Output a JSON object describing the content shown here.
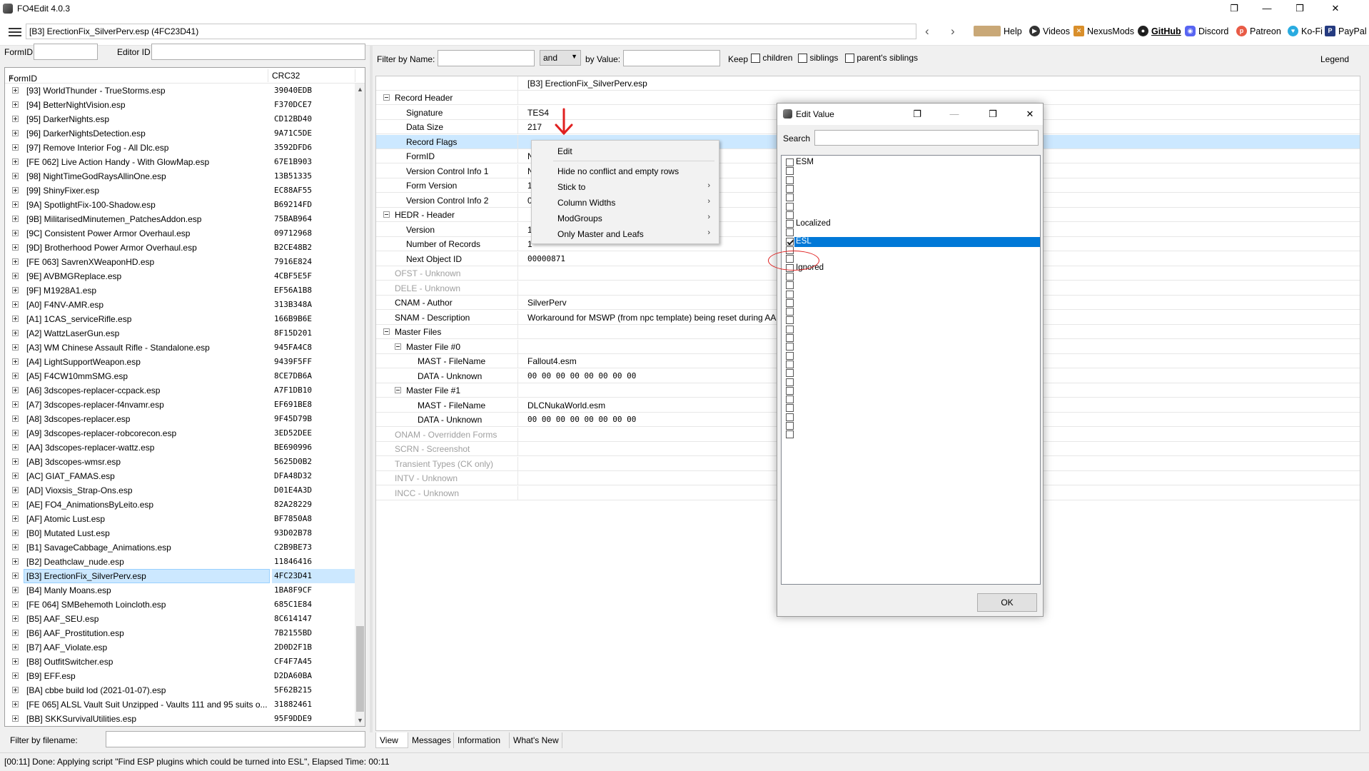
{
  "window": {
    "title": "FO4Edit 4.0.3",
    "controls": [
      "❐",
      "—",
      "❒",
      "✕"
    ]
  },
  "toolbar": {
    "path": "[B3] ErectionFix_SilverPerv.esp (4FC23D41)",
    "back": "‹",
    "forward": "›",
    "links": [
      {
        "label": "Help",
        "icon": "book-icon",
        "color": "#8a6a3a"
      },
      {
        "label": "Videos",
        "icon": "film-icon",
        "color": "#333333"
      },
      {
        "label": "NexusMods",
        "icon": "nexus-icon",
        "color": "#d98f2b"
      },
      {
        "label": "GitHub",
        "icon": "github-icon",
        "color": "#222222"
      },
      {
        "label": "Discord",
        "icon": "discord-icon",
        "color": "#5865f2"
      },
      {
        "label": "Patreon",
        "icon": "patreon-icon",
        "color": "#e85b46"
      },
      {
        "label": "Ko-Fi",
        "icon": "kofi-icon",
        "color": "#29abe0"
      },
      {
        "label": "PayPal",
        "icon": "paypal-icon",
        "color": "#253b80"
      }
    ]
  },
  "left": {
    "formid_label": "FormID",
    "formid_value": "",
    "editorid_label": "Editor ID",
    "editorid_value": "",
    "col_formid": "FormID",
    "col_crc": "CRC32",
    "filter_label": "Filter by filename:",
    "filter_value": "",
    "rows": [
      {
        "name": "[93] WorldThunder - TrueStorms.esp",
        "crc": "39040EDB"
      },
      {
        "name": "[94] BetterNightVision.esp",
        "crc": "F370DCE7"
      },
      {
        "name": "[95] DarkerNights.esp",
        "crc": "CD12BD40"
      },
      {
        "name": "[96] DarkerNightsDetection.esp",
        "crc": "9A71C5DE"
      },
      {
        "name": "[97] Remove Interior Fog - All Dlc.esp",
        "crc": "3592DFD6"
      },
      {
        "name": "[FE 062] Live Action Handy - With GlowMap.esp",
        "crc": "67E1B903"
      },
      {
        "name": "[98] NightTimeGodRaysAllinOne.esp",
        "crc": "13B51335"
      },
      {
        "name": "[99] ShinyFixer.esp",
        "crc": "EC88AF55"
      },
      {
        "name": "[9A] SpotlightFix-100-Shadow.esp",
        "crc": "B69214FD"
      },
      {
        "name": "[9B] MilitarisedMinutemen_PatchesAddon.esp",
        "crc": "75BAB964"
      },
      {
        "name": "[9C] Consistent Power Armor Overhaul.esp",
        "crc": "09712968"
      },
      {
        "name": "[9D] Brotherhood Power Armor Overhaul.esp",
        "crc": "B2CE48B2"
      },
      {
        "name": "[FE 063] SavrenXWeaponHD.esp",
        "crc": "7916E824"
      },
      {
        "name": "[9E] AVBMGReplace.esp",
        "crc": "4CBF5E5F"
      },
      {
        "name": "[9F] M1928A1.esp",
        "crc": "EF56A1B8"
      },
      {
        "name": "[A0] F4NV-AMR.esp",
        "crc": "313B348A"
      },
      {
        "name": "[A1] 1CAS_serviceRifle.esp",
        "crc": "166B9B6E"
      },
      {
        "name": "[A2] WattzLaserGun.esp",
        "crc": "8F15D201"
      },
      {
        "name": "[A3] WM Chinese Assault Rifle - Standalone.esp",
        "crc": "945FA4C8"
      },
      {
        "name": "[A4] LightSupportWeapon.esp",
        "crc": "9439F5FF"
      },
      {
        "name": "[A5] F4CW10mmSMG.esp",
        "crc": "8CE7DB6A"
      },
      {
        "name": "[A6] 3dscopes-replacer-ccpack.esp",
        "crc": "A7F1DB10"
      },
      {
        "name": "[A7] 3dscopes-replacer-f4nvamr.esp",
        "crc": "EF691BE8"
      },
      {
        "name": "[A8] 3dscopes-replacer.esp",
        "crc": "9F45D79B"
      },
      {
        "name": "[A9] 3dscopes-replacer-robcorecon.esp",
        "crc": "3ED52DEE"
      },
      {
        "name": "[AA] 3dscopes-replacer-wattz.esp",
        "crc": "BE690996"
      },
      {
        "name": "[AB] 3dscopes-wmsr.esp",
        "crc": "5625D0B2"
      },
      {
        "name": "[AC] GIAT_FAMAS.esp",
        "crc": "DFA48D32"
      },
      {
        "name": "[AD] Vioxsis_Strap-Ons.esp",
        "crc": "D01E4A3D"
      },
      {
        "name": "[AE] FO4_AnimationsByLeito.esp",
        "crc": "82A28229"
      },
      {
        "name": "[AF] Atomic Lust.esp",
        "crc": "BF7850A8"
      },
      {
        "name": "[B0] Mutated Lust.esp",
        "crc": "93D02B78"
      },
      {
        "name": "[B1] SavageCabbage_Animations.esp",
        "crc": "C2B9BE73"
      },
      {
        "name": "[B2] Deathclaw_nude.esp",
        "crc": "11846416"
      },
      {
        "name": "[B3] ErectionFix_SilverPerv.esp",
        "crc": "4FC23D41"
      },
      {
        "name": "[B4] Manly Moans.esp",
        "crc": "1BA8F9CF"
      },
      {
        "name": "[FE 064] SMBehemoth Loincloth.esp",
        "crc": "685C1E84"
      },
      {
        "name": "[B5] AAF_SEU.esp",
        "crc": "8C614147"
      },
      {
        "name": "[B6] AAF_Prostitution.esp",
        "crc": "7B2155BD"
      },
      {
        "name": "[B7] AAF_Violate.esp",
        "crc": "2D0D2F1B"
      },
      {
        "name": "[B8] OutfitSwitcher.esp",
        "crc": "CF4F7A45"
      },
      {
        "name": "[B9] EFF.esp",
        "crc": "D2DA60BA"
      },
      {
        "name": "[BA] cbbe build lod (2021-01-07).esp",
        "crc": "5F62B215"
      },
      {
        "name": "[FE 065] ALSL Vault Suit Unzipped - Vaults 111 and 95 suits o...",
        "crc": "31882461"
      },
      {
        "name": "[BB] SKKSurvivalUtilities.esp",
        "crc": "95F9DDE9"
      }
    ]
  },
  "right": {
    "filter_label": "Filter by Name:",
    "filter_name_value": "",
    "and_option": "and",
    "by_value_label": "by Value:",
    "by_value_value": "",
    "keep_label": "Keep",
    "children_label": "children",
    "siblings_label": "siblings",
    "parents_label": "parent's siblings",
    "legend_label": "Legend",
    "file_header": "[B3] ErectionFix_SilverPerv.esp",
    "rows": [
      {
        "key": "Record Header",
        "value": "",
        "level": 0,
        "toggle": true,
        "gray": false
      },
      {
        "key": "Signature",
        "value": "TES4",
        "level": 1,
        "toggle": false,
        "gray": false
      },
      {
        "key": "Data Size",
        "value": "217",
        "level": 1,
        "toggle": false,
        "gray": false
      },
      {
        "key": "Record Flags",
        "value": "",
        "level": 1,
        "toggle": false,
        "gray": false,
        "highlight": true
      },
      {
        "key": "FormID",
        "value": "N",
        "level": 1,
        "toggle": false,
        "gray": false
      },
      {
        "key": "Version Control Info 1",
        "value": "N",
        "level": 1,
        "toggle": false,
        "gray": false
      },
      {
        "key": "Form Version",
        "value": "1",
        "level": 1,
        "toggle": false,
        "gray": false
      },
      {
        "key": "Version Control Info 2",
        "value": "0",
        "level": 1,
        "toggle": false,
        "gray": false
      },
      {
        "key": "HEDR - Header",
        "value": "",
        "level": 0,
        "toggle": true,
        "gray": false
      },
      {
        "key": "Version",
        "value": "1",
        "level": 1,
        "toggle": false,
        "gray": false
      },
      {
        "key": "Number of Records",
        "value": "1",
        "level": 1,
        "toggle": false,
        "gray": false
      },
      {
        "key": "Next Object ID",
        "value": "00000871",
        "level": 1,
        "toggle": false,
        "gray": false,
        "mono": true
      },
      {
        "key": "OFST - Unknown",
        "value": "",
        "level": 0,
        "toggle": false,
        "gray": true
      },
      {
        "key": "DELE - Unknown",
        "value": "",
        "level": 0,
        "toggle": false,
        "gray": true
      },
      {
        "key": "CNAM - Author",
        "value": "SilverPerv",
        "level": 0,
        "toggle": false,
        "gray": false
      },
      {
        "key": "SNAM - Description",
        "value": "Workaround for MSWP (from npc template) being reset during AA",
        "level": 0,
        "toggle": false,
        "gray": false
      },
      {
        "key": "Master Files",
        "value": "",
        "level": 0,
        "toggle": true,
        "gray": false
      },
      {
        "key": "Master File #0",
        "value": "",
        "level": 1,
        "toggle": true,
        "gray": false
      },
      {
        "key": "MAST - FileName",
        "value": "Fallout4.esm",
        "level": 2,
        "toggle": false,
        "gray": false
      },
      {
        "key": "DATA - Unknown",
        "value": "00 00 00 00 00 00 00 00",
        "level": 2,
        "toggle": false,
        "gray": false,
        "mono": true
      },
      {
        "key": "Master File #1",
        "value": "",
        "level": 1,
        "toggle": true,
        "gray": false
      },
      {
        "key": "MAST - FileName",
        "value": "DLCNukaWorld.esm",
        "level": 2,
        "toggle": false,
        "gray": false
      },
      {
        "key": "DATA - Unknown",
        "value": "00 00 00 00 00 00 00 00",
        "level": 2,
        "toggle": false,
        "gray": false,
        "mono": true
      },
      {
        "key": "ONAM - Overridden Forms",
        "value": "",
        "level": 0,
        "toggle": false,
        "gray": true
      },
      {
        "key": "SCRN - Screenshot",
        "value": "",
        "level": 0,
        "toggle": false,
        "gray": true
      },
      {
        "key": "Transient Types (CK only)",
        "value": "",
        "level": 0,
        "toggle": false,
        "gray": true
      },
      {
        "key": "INTV - Unknown",
        "value": "",
        "level": 0,
        "toggle": false,
        "gray": true
      },
      {
        "key": "INCC - Unknown",
        "value": "",
        "level": 0,
        "toggle": false,
        "gray": true
      }
    ],
    "tabs": [
      "View",
      "Messages",
      "Information",
      "What's New"
    ]
  },
  "context_menu": {
    "items": [
      {
        "label": "Edit",
        "submenu": false
      },
      {
        "label": "Hide no conflict and empty rows",
        "submenu": false
      },
      {
        "label": "Stick to",
        "submenu": true
      },
      {
        "label": "Column Widths",
        "submenu": true
      },
      {
        "label": "ModGroups",
        "submenu": true
      },
      {
        "label": "Only Master and Leafs",
        "submenu": true
      }
    ],
    "submenu_arrow": "›"
  },
  "dialog": {
    "title": "Edit Value",
    "search_label": "Search",
    "search_value": "",
    "ok_label": "OK",
    "flags": [
      {
        "name": "ESM",
        "checked": false
      },
      {
        "name": "",
        "checked": false
      },
      {
        "name": "",
        "checked": false
      },
      {
        "name": "",
        "checked": false
      },
      {
        "name": "",
        "checked": false
      },
      {
        "name": "",
        "checked": false
      },
      {
        "name": "",
        "checked": false
      },
      {
        "name": "Localized",
        "checked": false
      },
      {
        "name": "",
        "checked": false
      },
      {
        "name": "ESL",
        "checked": true,
        "selected": true
      },
      {
        "name": "",
        "checked": false
      },
      {
        "name": "",
        "checked": false
      },
      {
        "name": "Ignored",
        "checked": false
      },
      {
        "name": "",
        "checked": false
      },
      {
        "name": "",
        "checked": false
      },
      {
        "name": "",
        "checked": false
      },
      {
        "name": "",
        "checked": false
      },
      {
        "name": "",
        "checked": false
      },
      {
        "name": "",
        "checked": false
      },
      {
        "name": "",
        "checked": false
      },
      {
        "name": "",
        "checked": false
      },
      {
        "name": "",
        "checked": false
      },
      {
        "name": "",
        "checked": false
      },
      {
        "name": "",
        "checked": false
      },
      {
        "name": "",
        "checked": false
      },
      {
        "name": "",
        "checked": false
      },
      {
        "name": "",
        "checked": false
      },
      {
        "name": "",
        "checked": false
      },
      {
        "name": "",
        "checked": false
      },
      {
        "name": "",
        "checked": false
      },
      {
        "name": "",
        "checked": false
      },
      {
        "name": "",
        "checked": false
      }
    ]
  },
  "status": {
    "text": "[00:11] Done: Applying script \"Find ESP plugins which could be turned into ESL\", Elapsed Time: 00:11"
  },
  "colors": {
    "selection": "#cce8ff",
    "list_selection": "#0078d7",
    "annotation": "#e02020"
  }
}
